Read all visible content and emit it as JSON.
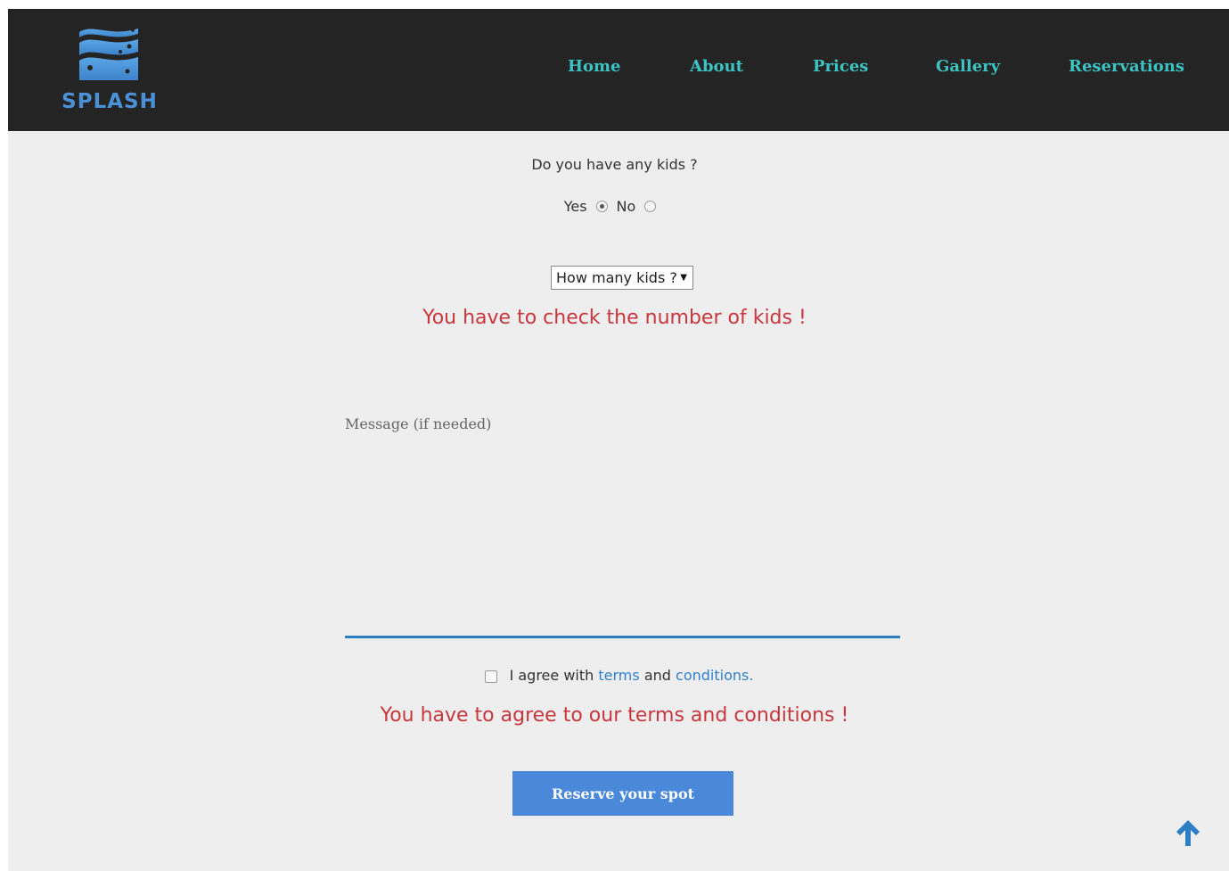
{
  "brand": {
    "name": "SPLASH"
  },
  "nav": {
    "items": [
      {
        "label": "Home"
      },
      {
        "label": "About"
      },
      {
        "label": "Prices"
      },
      {
        "label": "Gallery"
      },
      {
        "label": "Reservations"
      }
    ]
  },
  "form": {
    "kids_question": "Do you have any kids ?",
    "radio_yes": "Yes",
    "radio_no": "No",
    "selected_radio": "Yes",
    "kids_select_value": "How many kids ?",
    "kids_error": "You have to check the number of kids !",
    "message_label": "Message (if needed)",
    "message_value": "",
    "agree_prefix": "I agree with",
    "agree_terms": "terms",
    "agree_and": "and",
    "agree_conditions": "conditions.",
    "agree_checked": false,
    "agree_error": "You have to agree to our terms and conditions !",
    "submit_label": "Reserve your spot"
  },
  "icons": {
    "logo": "splash-waves-logo-icon",
    "scroll_top": "arrow-up-icon"
  },
  "colors": {
    "header_bg": "#242424",
    "nav_link": "#3cc4c4",
    "brand_blue": "#4a90d6",
    "error": "#c9363d",
    "button_bg": "#4a88d9",
    "link": "#2f7fd0",
    "page_bg": "#eeeeee"
  }
}
